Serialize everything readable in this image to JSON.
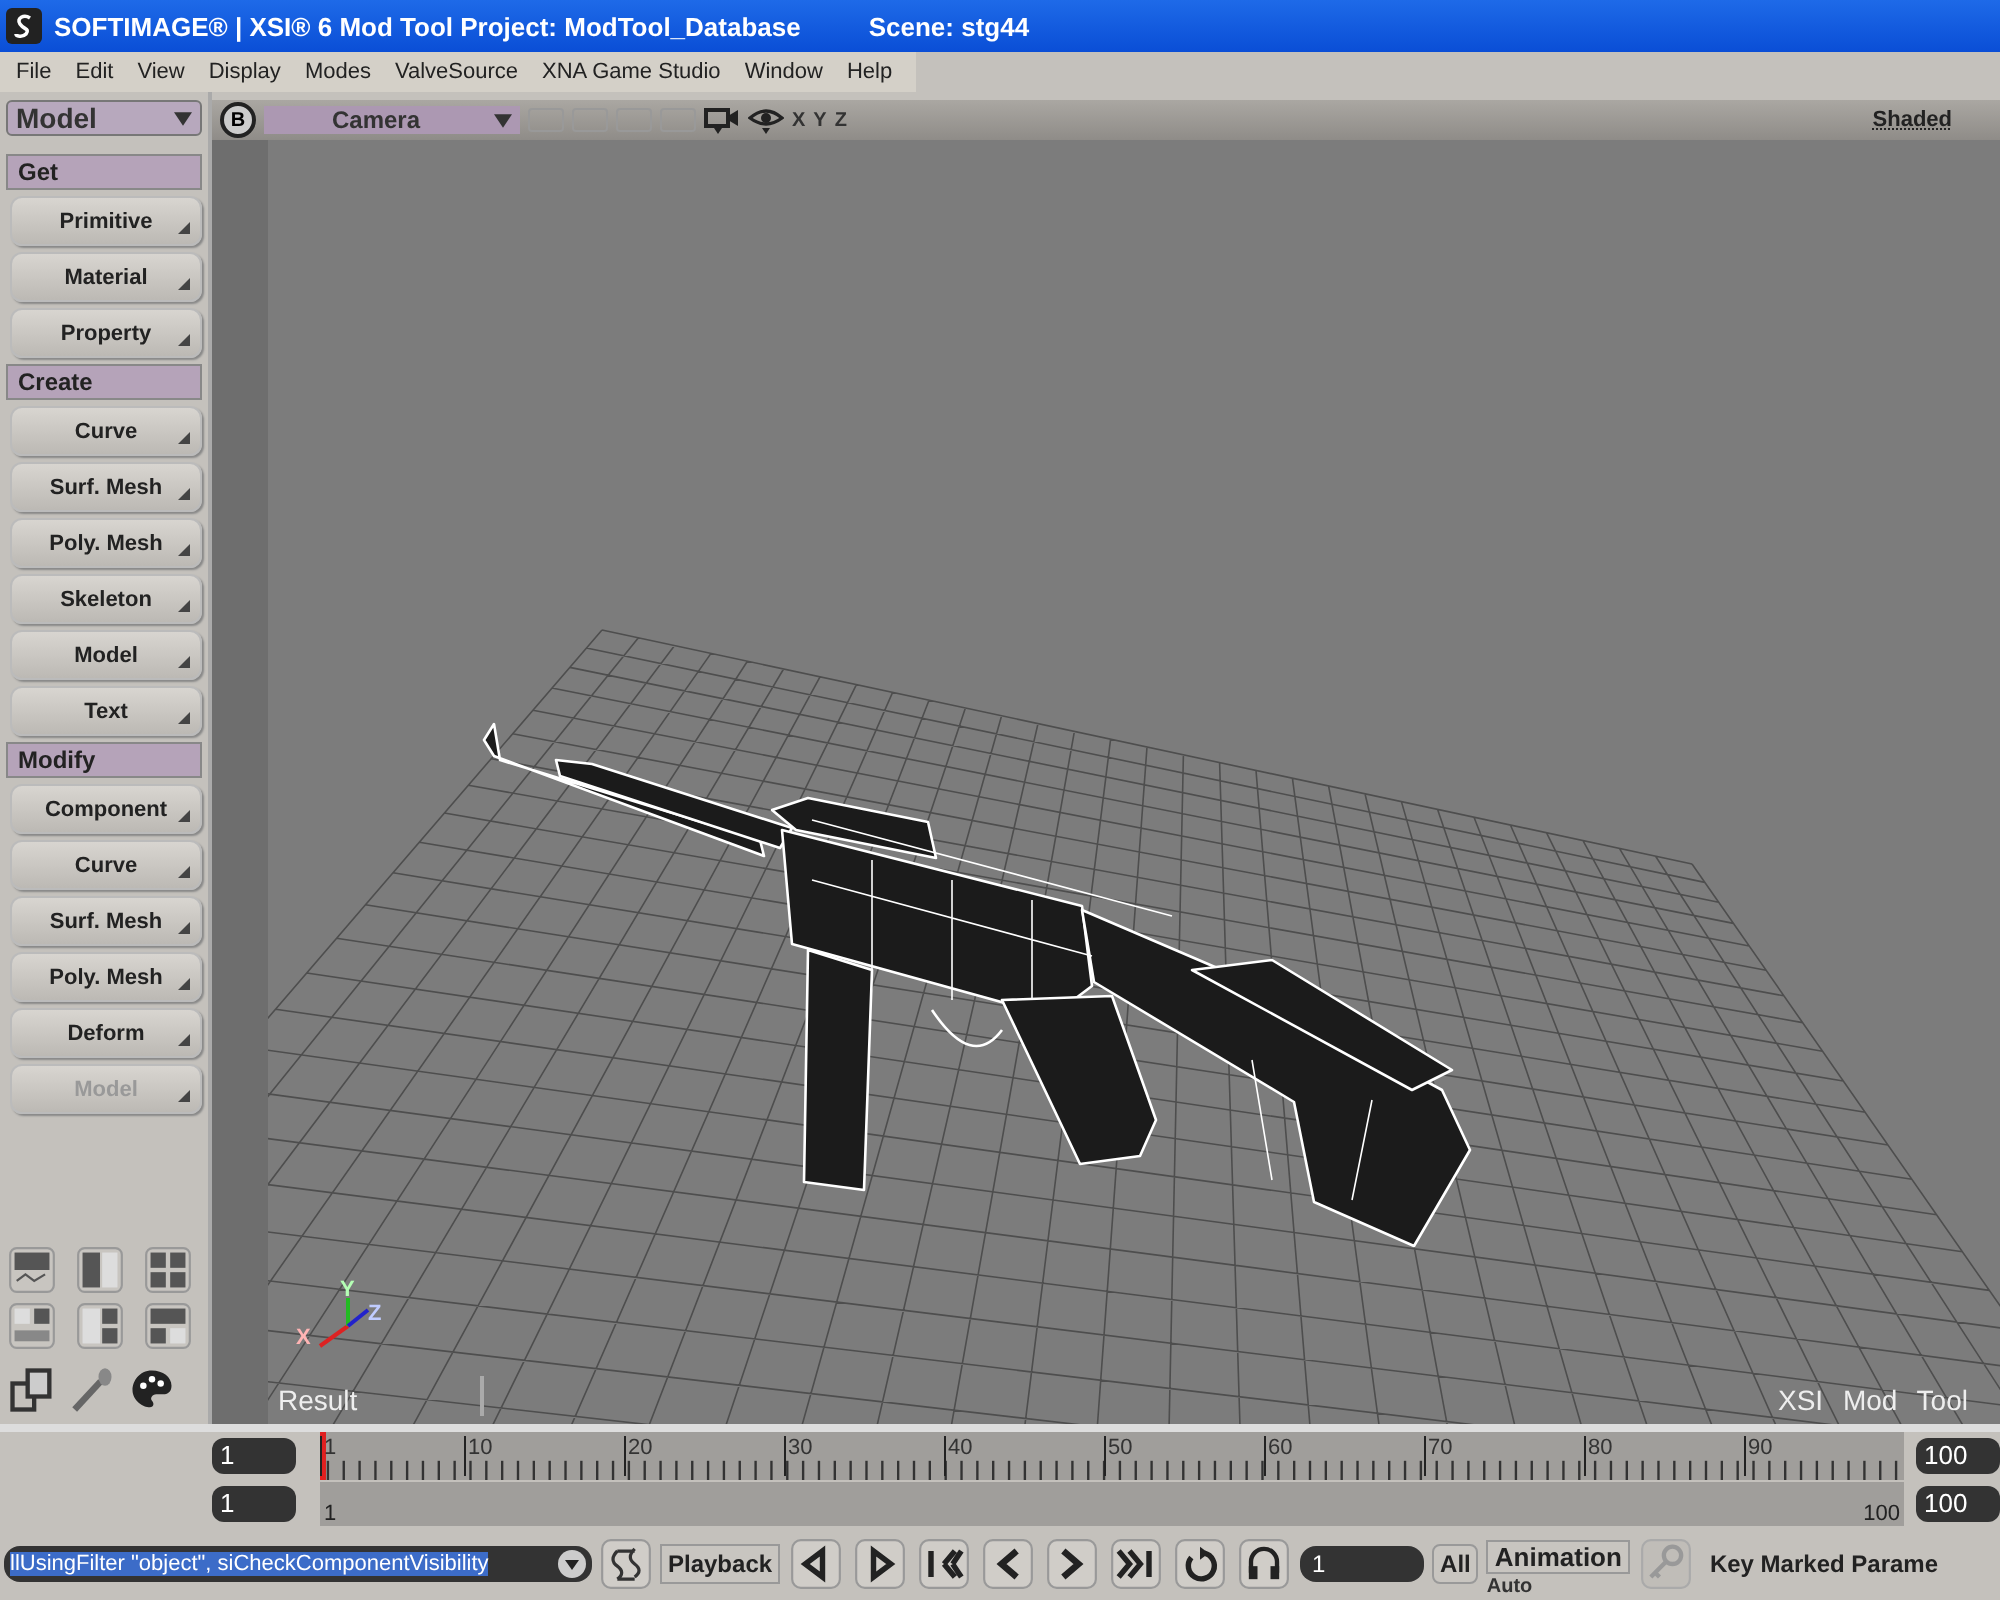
{
  "window": {
    "title": "SOFTIMAGE® | XSI® 6 Mod Tool Project: ModTool_Database",
    "scene": "Scene: stg44"
  },
  "menu": [
    "File",
    "Edit",
    "View",
    "Display",
    "Modes",
    "ValveSource",
    "XNA Game Studio",
    "Window",
    "Help"
  ],
  "left_panel": {
    "mode": "Model",
    "sections": [
      {
        "title": "Get",
        "buttons": [
          {
            "label": "Primitive",
            "disabled": false
          },
          {
            "label": "Material",
            "disabled": false
          },
          {
            "label": "Property",
            "disabled": false
          }
        ]
      },
      {
        "title": "Create",
        "buttons": [
          {
            "label": "Curve",
            "disabled": false
          },
          {
            "label": "Surf. Mesh",
            "disabled": false
          },
          {
            "label": "Poly. Mesh",
            "disabled": false
          },
          {
            "label": "Skeleton",
            "disabled": false
          },
          {
            "label": "Model",
            "disabled": false
          },
          {
            "label": "Text",
            "disabled": false
          }
        ]
      },
      {
        "title": "Modify",
        "buttons": [
          {
            "label": "Component",
            "disabled": false
          },
          {
            "label": "Curve",
            "disabled": false
          },
          {
            "label": "Surf. Mesh",
            "disabled": false
          },
          {
            "label": "Poly. Mesh",
            "disabled": false
          },
          {
            "label": "Deform",
            "disabled": false
          },
          {
            "label": "Model",
            "disabled": true
          }
        ]
      }
    ]
  },
  "viewport": {
    "view_button": "B",
    "camera": "Camera",
    "axes": [
      "X",
      "Y",
      "Z"
    ],
    "display_mode": "Shaded",
    "gizmo_axes": [
      "X",
      "Y",
      "Z"
    ],
    "label_left": "Result",
    "label_right": "XSI Mod Tool"
  },
  "timeline": {
    "start": "1",
    "current": "1",
    "ticks": [
      "1",
      "10",
      "20",
      "30",
      "40",
      "50",
      "60",
      "70",
      "80",
      "90"
    ],
    "range_start": "1",
    "range_end": "100",
    "end": "100",
    "range_end_field": "100"
  },
  "bottom_bar": {
    "command": "llUsingFilter \"object\", siCheckComponentVisibility",
    "playback": "Playback",
    "frame": "1",
    "all": "All",
    "animation": "Animation",
    "auto": "Auto",
    "key_panel": "Key Marked Parame"
  }
}
